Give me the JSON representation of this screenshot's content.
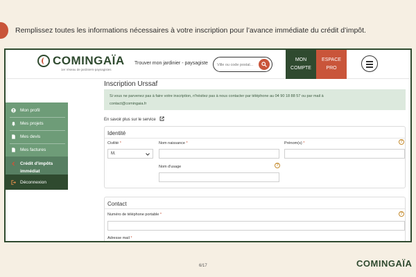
{
  "instruction": "Remplissez toutes les informations nécessaires à votre inscription pour l’avance immédiate du crédit d’impôt.",
  "header": {
    "logo_text": "COMINGAÏA",
    "logo_tagline": "1er réseau de jardiniers-paysagistes",
    "find_gardener": "Trouver mon jardinier - paysagiste",
    "search_placeholder": "Ville ou code postal...",
    "account_line1": "MON",
    "account_line2": "COMPTE",
    "pro_line1": "ESPACE",
    "pro_line2": "PRO",
    "accent_color": "#c9553a",
    "brand_color": "#2f4a2f"
  },
  "sidebar": {
    "items": [
      {
        "label": "Mon profil",
        "icon": "user-icon"
      },
      {
        "label": "Mes projets",
        "icon": "bell-icon"
      },
      {
        "label": "Mes devis",
        "icon": "document-icon"
      },
      {
        "label": "Mes factures",
        "icon": "document-icon"
      },
      {
        "label": "Crédit d'impôts immédiat",
        "icon": "chevron-left-icon"
      }
    ],
    "logout_label": "Déconnexion"
  },
  "content": {
    "title": "Inscription Urssaf",
    "alert_line1": "Si vous ne parvenez pas à faire votre inscription, n'hésitez pas à nous contacter par téléphone au 04 90 18 88 57 ou par mail à",
    "alert_line2": "contact@comingaia.fr",
    "service_link": "En savoir plus sur le service"
  },
  "identity": {
    "title": "Identité",
    "civility_label": "Civilité",
    "civility_value": "M.",
    "birth_name_label": "Nom naissance",
    "first_name_label": "Prénom(s)",
    "usage_name_label": "Nom d'usage",
    "required_mark": "*",
    "help_mark": "?"
  },
  "contact": {
    "title": "Contact",
    "phone_label": "Numéro de téléphone portable",
    "email_label": "Adresse mail"
  },
  "footer": {
    "page": "6/17",
    "logo_text": "COMINGAÏA"
  }
}
